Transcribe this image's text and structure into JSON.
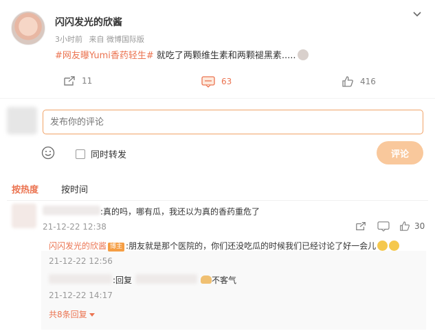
{
  "post": {
    "author": "闪闪发光的欣酱",
    "time": "3小时前",
    "source": "来自 微博国际版",
    "hashtag": "#网友曝Yumi香药轻生#",
    "text": " 就吃了两颗维生素和两颗褪黑素.....",
    "repost_count": "11",
    "comment_count": "63",
    "like_count": "416"
  },
  "composer": {
    "placeholder": "发布你的评论",
    "repost_label": "同时转发",
    "submit_label": "评论"
  },
  "tabs": {
    "hot": "按热度",
    "time": "按时间"
  },
  "comments": [
    {
      "text": ":真的吗，哪有瓜，我还以为真的香药重危了",
      "time": "21-12-22 12:38",
      "like_count": "30",
      "replies": [
        {
          "name": "闪闪发光的欣酱",
          "badge": "博主",
          "text": ":朋友就是那个医院的，你们还没吃瓜的时候我们已经讨论了好一会儿",
          "time": "21-12-22 12:56"
        },
        {
          "text_prefix": ":回复",
          "text_suffix": "不客气",
          "time": "21-12-22 14:17"
        }
      ],
      "more_replies": "共8条回复"
    }
  ],
  "colors": {
    "accent": "#eb7350",
    "submit_bg": "#f9c89c",
    "input_border": "#f0a266"
  }
}
